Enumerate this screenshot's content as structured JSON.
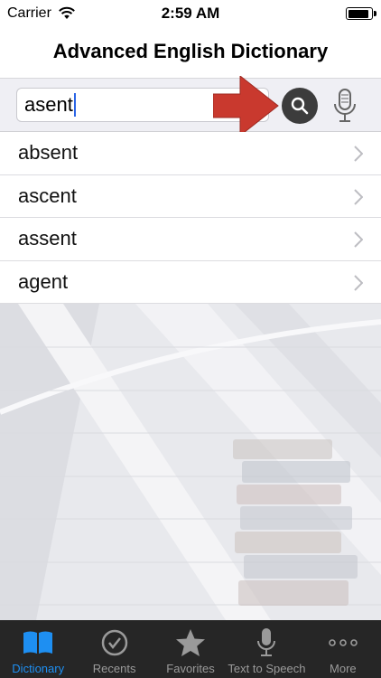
{
  "status_bar": {
    "carrier": "Carrier",
    "time": "2:59 AM",
    "battery_level": 0.9
  },
  "nav": {
    "title": "Advanced English Dictionary"
  },
  "search": {
    "value": "asent"
  },
  "results": [
    {
      "word": "absent"
    },
    {
      "word": "ascent"
    },
    {
      "word": "assent"
    },
    {
      "word": "agent"
    }
  ],
  "tabs": [
    {
      "label": "Dictionary",
      "icon": "book-icon",
      "active": true
    },
    {
      "label": "Recents",
      "icon": "clock-icon",
      "active": false
    },
    {
      "label": "Favorites",
      "icon": "star-icon",
      "active": false
    },
    {
      "label": "Text to Speech",
      "icon": "microphone-icon",
      "active": false
    },
    {
      "label": "More",
      "icon": "more-dots-icon",
      "active": false
    }
  ],
  "colors": {
    "accent": "#1e8ff2",
    "tab_bar_bg": "#262626",
    "tab_inactive": "#9a9a9a",
    "search_button": "#3c3c3c",
    "annotation_arrow": "#c9392e"
  }
}
